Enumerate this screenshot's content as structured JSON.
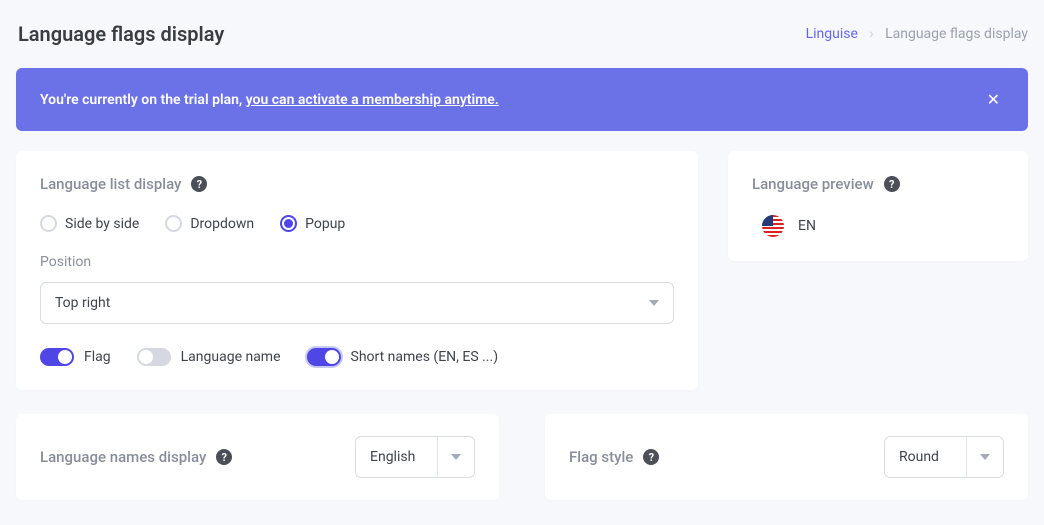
{
  "header": {
    "title": "Language flags display",
    "breadcrumb": {
      "root": "Linguise",
      "current": "Language flags display"
    }
  },
  "banner": {
    "message_prefix": "You're currently on the trial plan, ",
    "message_link": "you can activate a membership anytime."
  },
  "main": {
    "section_title": "Language list display",
    "radios": {
      "side_by_side": "Side by side",
      "dropdown": "Dropdown",
      "popup": "Popup",
      "selected": "popup"
    },
    "position": {
      "label": "Position",
      "value": "Top right"
    },
    "toggles": {
      "flag": {
        "label": "Flag",
        "on": true
      },
      "language_name": {
        "label": "Language name",
        "on": false
      },
      "short_names": {
        "label": "Short names (EN, ES ...)",
        "on": true
      }
    }
  },
  "preview": {
    "title": "Language preview",
    "code": "EN"
  },
  "names_display": {
    "title": "Language names display",
    "value": "English"
  },
  "flag_style": {
    "title": "Flag style",
    "value": "Round"
  }
}
